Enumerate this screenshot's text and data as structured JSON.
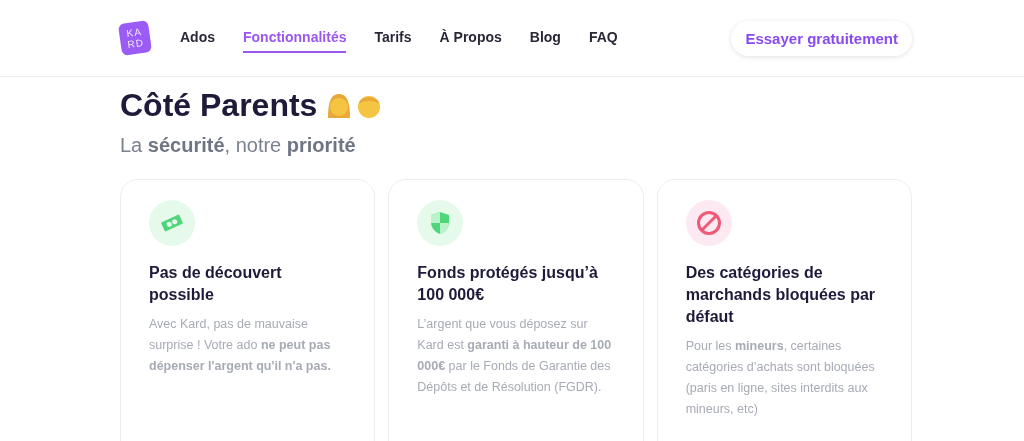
{
  "logo": {
    "line1": "KA",
    "line2": "RD"
  },
  "nav": [
    {
      "label": "Ados",
      "selected": false
    },
    {
      "label": "Fonctionnalités",
      "selected": true
    },
    {
      "label": "Tarifs",
      "selected": false
    },
    {
      "label": "À Propos",
      "selected": false
    },
    {
      "label": "Blog",
      "selected": false
    },
    {
      "label": "FAQ",
      "selected": false
    }
  ],
  "cta": "Essayer gratuitement",
  "heading": "Côté Parents",
  "subheading": "La **sécurité**, notre **priorité**",
  "cards": [
    {
      "kind": "money",
      "title": "Pas de découvert possible",
      "text": "Avec Kard, pas de mauvaise surprise ! Votre ado **ne peut pas dépenser l'argent qu'il n'a pas.**"
    },
    {
      "kind": "shield",
      "title": "Fonds protégés jusqu’à 100 000€",
      "text": "L’argent que vous déposez sur Kard est **garanti à hauteur de 100 000€** par le Fonds de Garantie des Dépôts et de Résolution (FGDR)."
    },
    {
      "kind": "blocked",
      "title": "Des catégories de marchands bloquées par défaut",
      "text": "Pour les **mineurs**, certaines catégories d’achats sont bloquées (paris en ligne, sites interdits aux mineurs, etc)"
    }
  ]
}
